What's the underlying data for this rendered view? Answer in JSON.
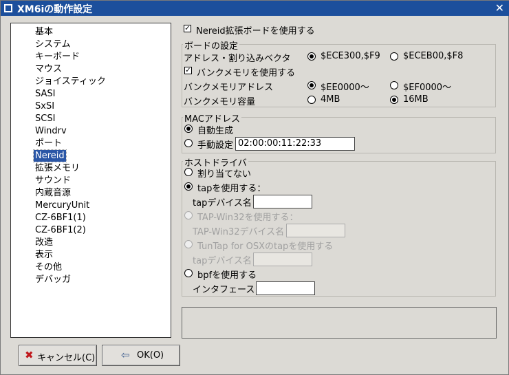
{
  "window": {
    "title": "XM6iの動作設定"
  },
  "icons": {
    "title": "window-menu-icon",
    "close": "close-icon",
    "cancel": "cancel-x-icon",
    "ok": "ok-arrow-icon"
  },
  "categories": [
    "基本",
    "システム",
    "キーボード",
    "マウス",
    "ジョイスティック",
    "SASI",
    "SxSI",
    "SCSI",
    "Windrv",
    "ポート",
    "Nereid",
    "拡張メモリ",
    "サウンド",
    "内蔵音源",
    "MercuryUnit",
    "CZ-6BF1(1)",
    "CZ-6BF1(2)",
    "改造",
    "表示",
    "その他",
    "デバッガ"
  ],
  "selected_category": "Nereid",
  "nereid": {
    "enable_label": "Nereid拡張ボードを使用する",
    "enable_checked": true,
    "board": {
      "title": "ボードの設定",
      "address_label": "アドレス・割り込みベクタ",
      "address_opt1": "$ECE300,$F9",
      "address_opt2": "$ECEB00,$F8",
      "bank_enable_label": "バンクメモリを使用する",
      "bank_enable_checked": true,
      "bank_addr_label": "バンクメモリアドレス",
      "bank_addr_opt1": "$EE0000～",
      "bank_addr_opt2": "$EF0000～",
      "bank_size_label": "バンクメモリ容量",
      "bank_size_opt1": "4MB",
      "bank_size_opt2": "16MB"
    },
    "mac": {
      "title": "MACアドレス",
      "auto_label": "自動生成",
      "manual_label": "手動設定",
      "manual_value": "02:00:00:11:22:33"
    },
    "host": {
      "title": "ホストドライバ",
      "none_label": "割り当てない",
      "tap_label": "tapを使用する：",
      "tap_dev_label": "tapデバイス名",
      "tap_dev_value": "",
      "win32_label": "TAP-Win32を使用する：",
      "win32_dev_label": "TAP-Win32デバイス名",
      "win32_dev_value": "",
      "osx_label": "TunTap for OSXのtapを使用する",
      "osx_dev_label": "tapデバイス名",
      "osx_dev_value": "",
      "bpf_label": "bpfを使用する",
      "bpf_if_label": "インタフェース",
      "bpf_if_value": ""
    }
  },
  "buttons": {
    "cancel": "キャンセル(C)",
    "ok": "OK(O)"
  }
}
